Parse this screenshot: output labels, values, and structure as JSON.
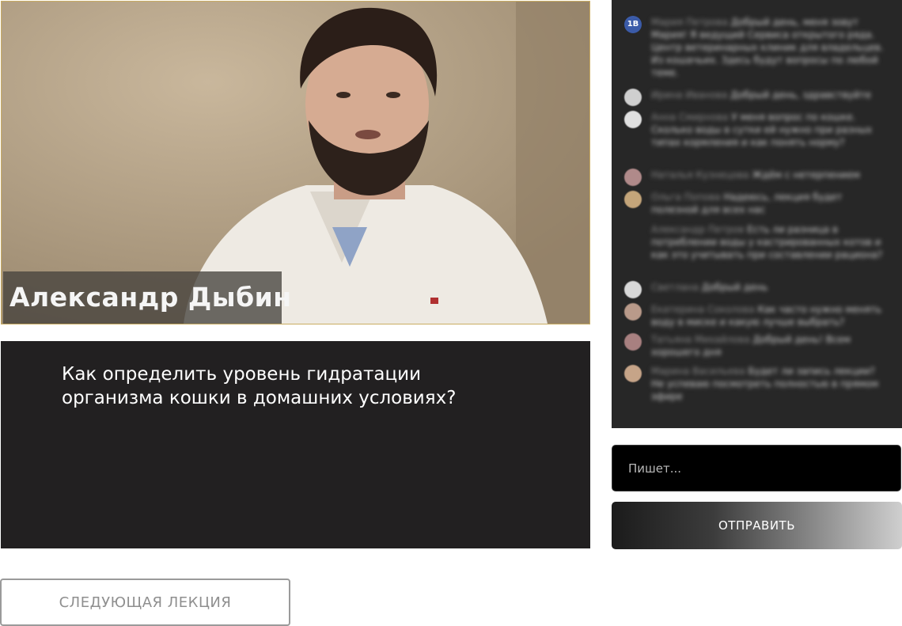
{
  "video": {
    "speaker_caption": "Александр Дыбин"
  },
  "question": {
    "line1": "Как определить уровень гидратации",
    "line2": "организма кошки в домашних условиях?"
  },
  "chat": {
    "brand_avatar_label": "1B",
    "messages": [
      {
        "author": "Мария Петрова",
        "text": "Добрый день, меня зовут Мария! Я ведущий Сервиса открытого ряда. Центр ветеринарных клиник для владельцев. Из кошачьих. Здесь будут вопросы по любой теме.",
        "avatar": "brand"
      },
      {
        "author": "Ирина Иванова",
        "text": "Добрый день, здравствуйте",
        "avatar": "#cfcfcf"
      },
      {
        "author": "Анна Смирнова",
        "text": "У меня вопрос по кошке. Сколько воды в сутки ей нужно при разных типах кормления и как понять норму?",
        "avatar": "#e0e0e0"
      },
      {
        "author": "Наталья Кузнецова",
        "text": "Ждём с нетерпением",
        "avatar": "#b08a8a"
      },
      {
        "author": "Ольга Попова",
        "text": "Надеюсь, лекция будет полезной для всех нас",
        "avatar": "#c4a57a"
      },
      {
        "author": "Александр Петров",
        "text": "Есть ли разница в потреблении воды у кастрированных котов и как это учитывать при составлении рациона?",
        "avatar": "none"
      },
      {
        "author": "Светлана",
        "text": "Добрый день",
        "avatar": "#d8d8d8"
      },
      {
        "author": "Екатерина Соколова",
        "text": "Как часто нужно менять воду в миске и какую лучше выбрать?",
        "avatar": "#b99a8a"
      },
      {
        "author": "Татьяна Михайлова",
        "text": "Добрый день! Всем хорошего дня",
        "avatar": "#a88080"
      },
      {
        "author": "Марина Васильева",
        "text": "Будет ли запись лекции? Не успеваю посмотреть полностью в прямом эфире",
        "avatar": "#c6a488"
      }
    ]
  },
  "input": {
    "placeholder": "Пишет..."
  },
  "send_button": {
    "label": "ОТПРАВИТЬ"
  },
  "next_button": {
    "label": "СЛЕДУЮЩАЯ ЛЕКЦИЯ"
  }
}
